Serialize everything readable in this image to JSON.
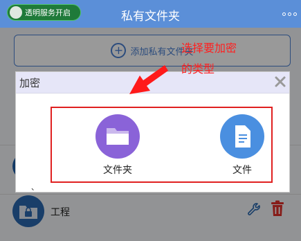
{
  "header": {
    "service_pill_label": "透明服务开启",
    "title": "私有文件夹"
  },
  "toolbar": {
    "add_label": "添加私有文件夹"
  },
  "list": {
    "items": [
      {
        "label": ""
      },
      {
        "label": "工程"
      }
    ]
  },
  "dialog": {
    "title": "加密",
    "options": [
      {
        "label": "文件夹",
        "icon": "folder-icon",
        "color": "#8a63d8"
      },
      {
        "label": "文件",
        "icon": "document-icon",
        "color": "#4a8fe0"
      }
    ],
    "stray_mark": "、"
  },
  "annotation": {
    "text_line_1": "选择要加密",
    "text_line_2": "的类型",
    "color": "#ff2020"
  },
  "colors": {
    "accent": "#4a7fd1",
    "header_bg": "#5b8fd8",
    "delete": "#e0302a"
  }
}
